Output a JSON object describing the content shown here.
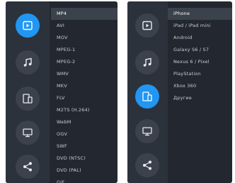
{
  "left_panel": {
    "active_button": "video",
    "formats": [
      "MP4",
      "AVI",
      "MOV",
      "MPEG-1",
      "MPEG-2",
      "WMV",
      "MKV",
      "FLV",
      "M2TS (H.264)",
      "WebM",
      "OGV",
      "SWF",
      "DVD (NTSC)",
      "DVD (PAL)",
      "GIF"
    ],
    "selected_index": 0
  },
  "right_panel": {
    "active_button": "devices",
    "devices": [
      "iPhone",
      "iPad / iPad mini",
      "Android",
      "Galaxy S6 / S7",
      "Nexus 6 / Pixel",
      "PlayStation",
      "Xbox 360",
      "Другие"
    ],
    "selected_index": 0
  },
  "icons": {
    "video": "play-square-icon",
    "audio": "music-note-icon",
    "devices": "devices-icon",
    "monitor": "monitor-icon",
    "share": "share-icon"
  },
  "colors": {
    "panel_bg": "#232830",
    "sidebar_bg": "#2c323b",
    "button_bg": "#3b424c",
    "accent": "#2196f3",
    "selected_row_bg": "#3b424b",
    "text": "#c6ccd6"
  }
}
